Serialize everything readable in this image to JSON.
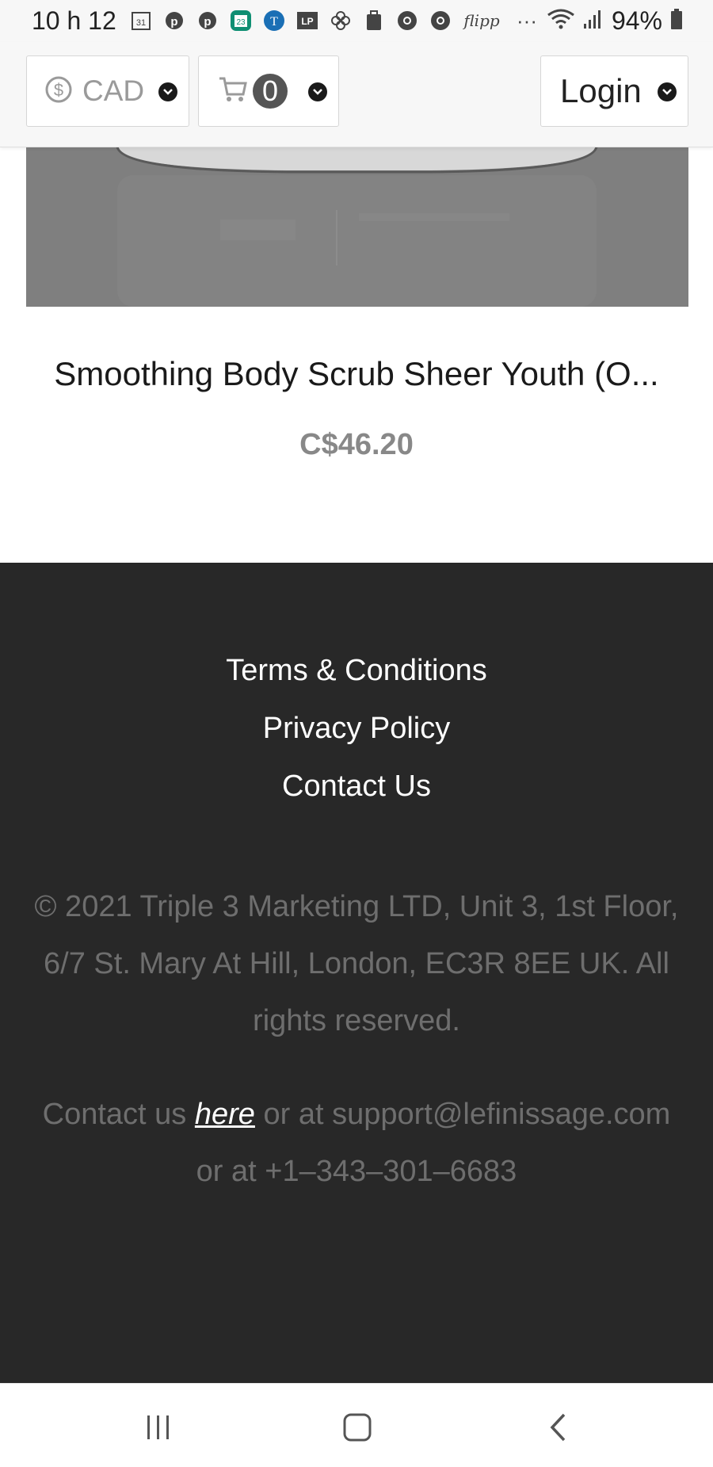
{
  "status_bar": {
    "time": "10 h 12",
    "battery": "94%",
    "calendar_badge": "31",
    "green_badge": "23",
    "lp_badge": "LP",
    "flipp_label": "flipp",
    "more": "···"
  },
  "header": {
    "currency": {
      "label": "CAD",
      "icon": "dollar-circle-icon"
    },
    "cart": {
      "count": "0",
      "icon": "cart-icon"
    },
    "login": {
      "label": "Login"
    }
  },
  "product": {
    "title": "Smoothing Body Scrub Sheer Youth (O...",
    "price": "C$46.20"
  },
  "footer": {
    "links": [
      "Terms & Conditions",
      "Privacy Policy",
      "Contact Us"
    ],
    "copyright": "© 2021 Triple 3 Marketing LTD, Unit 3, 1st Floor, 6/7 St. Mary At Hill, London, EC3R 8EE UK. All rights reserved.",
    "contact_prefix": "Contact us",
    "contact_link": "here",
    "contact_suffix": "or at support@lefinissage.com or at +1–343–301–6683"
  },
  "colors": {
    "footer_bg": "#282828",
    "header_bg": "#f7f7f7",
    "price": "#888888"
  }
}
